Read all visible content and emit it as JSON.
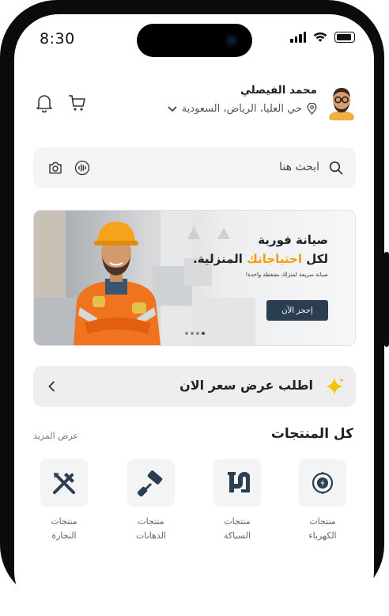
{
  "status_bar": {
    "time": "8:30"
  },
  "header": {
    "user_name": "محمد الفيصلي",
    "location": "حي العليا، الرياض، السعودية"
  },
  "search": {
    "placeholder": "ابحث هنا"
  },
  "banner": {
    "title_line1": "صيانة فورية",
    "title_line2_prefix": "لكل",
    "title_line2_highlight": "احتياجاتك",
    "title_line2_suffix": "المنزلية.",
    "subtitle": "صيانة سريعة لمنزلك بضغطة واحدة!",
    "cta_label": "إحجز الآن",
    "highlight_color": "#f39c12",
    "cta_color": "#2b3d51"
  },
  "quote_card": {
    "label": "اطلب عرض سعر الان"
  },
  "products_section": {
    "title": "كل المنتجات",
    "see_more": "عرض المزيد",
    "categories": [
      {
        "line1": "منتجات",
        "line2": "الكهرباء",
        "icon": "electricity-icon"
      },
      {
        "line1": "منتجات",
        "line2": "السباكة",
        "icon": "plumbing-icon"
      },
      {
        "line1": "منتجات",
        "line2": "الدهانات",
        "icon": "paint-roller-icon"
      },
      {
        "line1": "منتجات",
        "line2": "النجارة",
        "icon": "carpentry-tools-icon"
      }
    ]
  }
}
